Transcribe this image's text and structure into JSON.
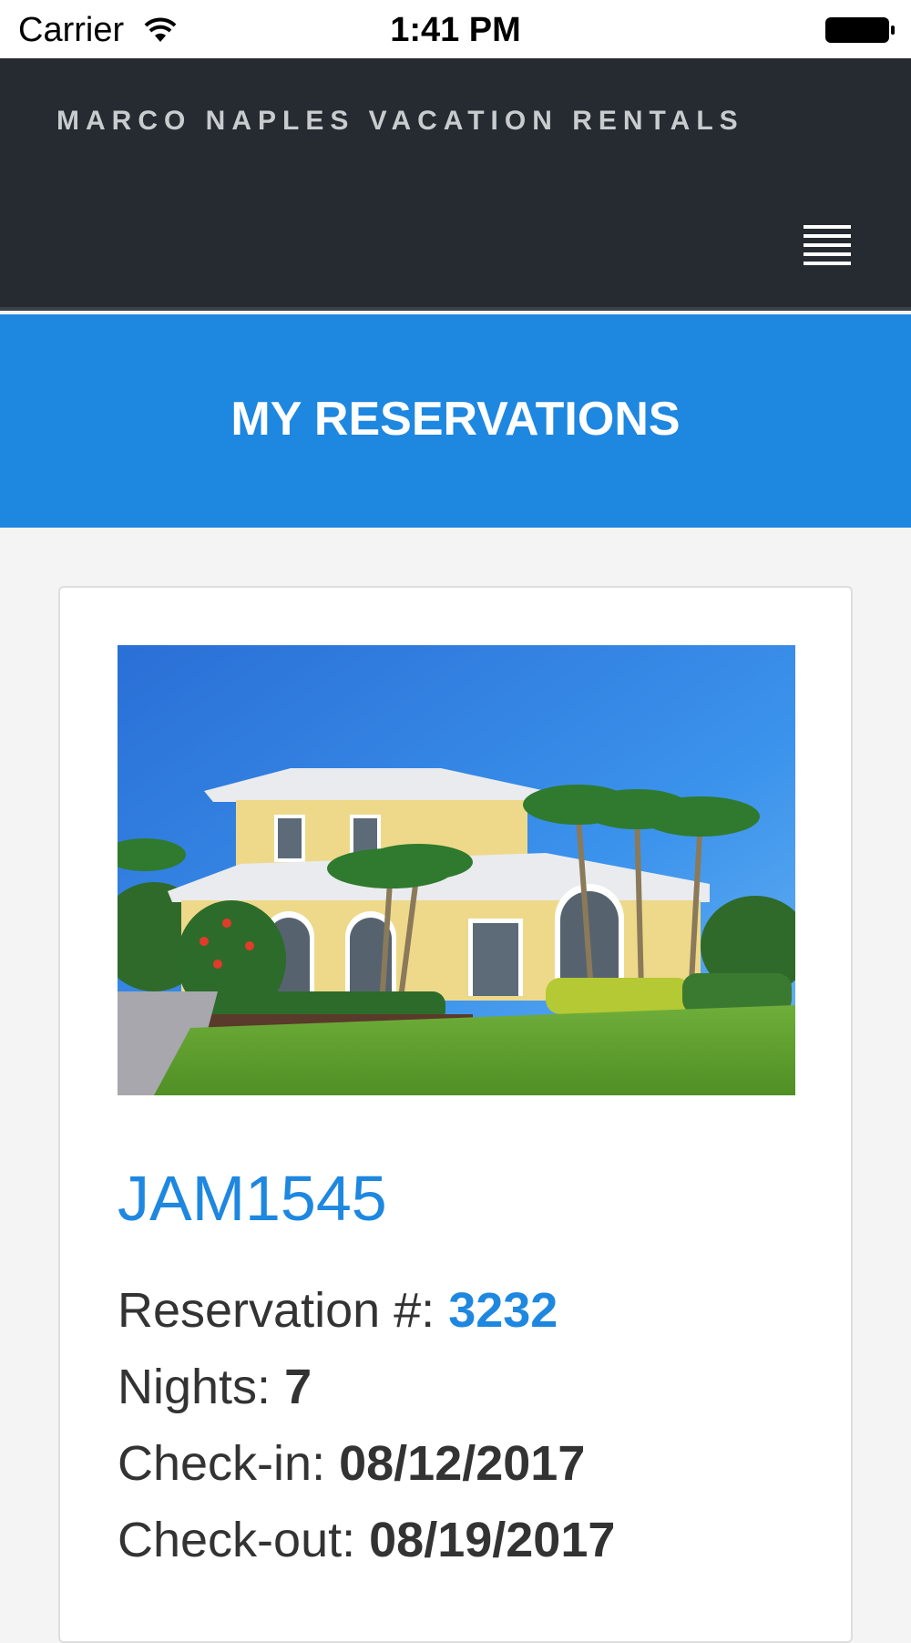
{
  "status_bar": {
    "carrier": "Carrier",
    "time": "1:41 PM"
  },
  "header": {
    "brand": "MARCO NAPLES VACATION RENTALS",
    "menu_icon": "hamburger-menu-icon"
  },
  "banner": {
    "title": "MY RESERVATIONS"
  },
  "reservation": {
    "property_name": "JAM1545",
    "reservation_label": "Reservation #:",
    "reservation_number": "3232",
    "nights_label": "Nights:",
    "nights": "7",
    "checkin_label": "Check-in:",
    "checkin": "08/12/2017",
    "checkout_label": "Check-out:",
    "checkout": "08/19/2017"
  },
  "colors": {
    "header_bg": "#252b30",
    "accent": "#1e87e0",
    "page_bg": "#f4f4f4"
  }
}
